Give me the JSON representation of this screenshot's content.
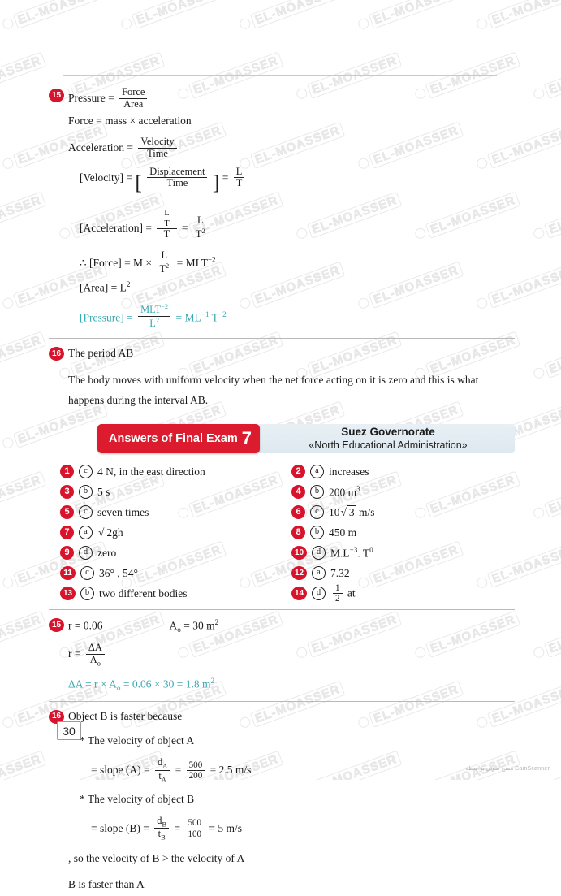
{
  "document": {
    "page_number": "30",
    "watermark_text": "EL-MOASSER",
    "scanner_note": "مسح ضوئي بواسطة CamScanner"
  },
  "colors": {
    "badge_red": "#d8142c",
    "banner_red": "#dc1c2e",
    "banner_panel": "#e8f0f5",
    "accent_teal": "#3aa8b0",
    "rule_gray": "#c9c9c9"
  },
  "question_15_dimensions": {
    "number": "15",
    "lines": {
      "l1_label": "Pressure",
      "l1_eq": "=",
      "l1_num": "Force",
      "l1_den": "Area",
      "l2": "Force = mass × acceleration",
      "l3_label": "Acceleration",
      "l3_eq": "=",
      "l3_num": "Velocity",
      "l3_den": "Time",
      "l4_label": "[Velocity] =",
      "l4_num": "Displacement",
      "l4_den": "Time",
      "l4_eq": "=",
      "l4_rnum": "L",
      "l4_rden": "T",
      "l5_label": "[Acceleration] =",
      "l5_num_top": "L",
      "l5_num_bot": "T",
      "l5_den": "T",
      "l5_eq": "=",
      "l5_rnum": "L",
      "l5_rden": "T",
      "l5_rden_sup": "2",
      "l6_label": "∴ [Force] = M ×",
      "l6_num": "L",
      "l6_den": "T",
      "l6_den_sup": "2",
      "l6_eq": "= MLT",
      "l6_sup": "−2",
      "l7": "[Area] = L",
      "l7_sup": "2",
      "l8_label": "[Pressure] =",
      "l8_num": "MLT",
      "l8_num_sup": "−2",
      "l8_den": "L",
      "l8_den_sup": "2",
      "l8_eq": "=",
      "l8_result": "ML",
      "l8_result_sup1": "−1",
      "l8_result_mid": " T",
      "l8_result_sup2": "−2"
    }
  },
  "question_16_period": {
    "number": "16",
    "heading": "The period AB",
    "body": "The body moves with uniform velocity when the net force acting on it is zero and this is what happens during the interval AB."
  },
  "exam_banner": {
    "title": "Answers of Final Exam",
    "exam_number": "7",
    "governorate": "Suez Governorate",
    "administration": "«North Educational Administration»"
  },
  "answers": {
    "left_column": [
      {
        "q": "1",
        "choice": "c",
        "text": "4 N, in the east direction"
      },
      {
        "q": "3",
        "choice": "b",
        "text": "5 s"
      },
      {
        "q": "5",
        "choice": "c",
        "text": "seven times"
      },
      {
        "q": "7",
        "choice": "a",
        "text": "√2gh"
      },
      {
        "q": "9",
        "choice": "d",
        "text": "zero"
      },
      {
        "q": "11",
        "choice": "c",
        "text": "36° , 54°"
      },
      {
        "q": "13",
        "choice": "b",
        "text": "two different bodies"
      }
    ],
    "right_column": [
      {
        "q": "2",
        "choice": "a",
        "text": "increases"
      },
      {
        "q": "4",
        "choice": "b",
        "text": "200 m³"
      },
      {
        "q": "6",
        "choice": "c",
        "text": "10√3 m/s"
      },
      {
        "q": "8",
        "choice": "b",
        "text": "450 m"
      },
      {
        "q": "10",
        "choice": "d",
        "text": "M.L⁻³ . T⁰"
      },
      {
        "q": "12",
        "choice": "a",
        "text": "7.32"
      },
      {
        "q": "14",
        "choice": "d",
        "text": "½ at"
      }
    ]
  },
  "question_15_solution": {
    "number": "15",
    "given_r": "r = 0.06",
    "given_a": "A",
    "given_a_sub": "o",
    "given_a_val": "= 30 m",
    "given_a_sup": "2",
    "ratio_label": "r =",
    "ratio_num": "ΔA",
    "ratio_den": "A",
    "ratio_den_sub": "o",
    "result_line": "ΔA = r × A",
    "result_sub": "o",
    "result_calc": " = 0.06 × 30 = ",
    "result_value": "1.8 m",
    "result_value_sup": "2"
  },
  "question_16_solution": {
    "number": "16",
    "heading": "Object B is faster because",
    "bullet_a": "* The velocity of object A",
    "slope_a_label": "= slope (A) =",
    "slope_a_num": "d",
    "slope_a_num_sub": "A",
    "slope_a_den": "t",
    "slope_a_den_sub": "A",
    "slope_a_eq": "=",
    "slope_a_fnum": "500",
    "slope_a_fden": "200",
    "slope_a_result": "= 2.5 m/s",
    "bullet_b": "* The velocity of object B",
    "slope_b_label": "= slope (B) =",
    "slope_b_num": "d",
    "slope_b_num_sub": "B",
    "slope_b_den": "t",
    "slope_b_den_sub": "B",
    "slope_b_eq": "=",
    "slope_b_fnum": "500",
    "slope_b_fden": "100",
    "slope_b_result": "= 5 m/s",
    "conclusion_1": ", so the velocity of B > the velocity of A",
    "conclusion_2": "B is faster than A"
  }
}
